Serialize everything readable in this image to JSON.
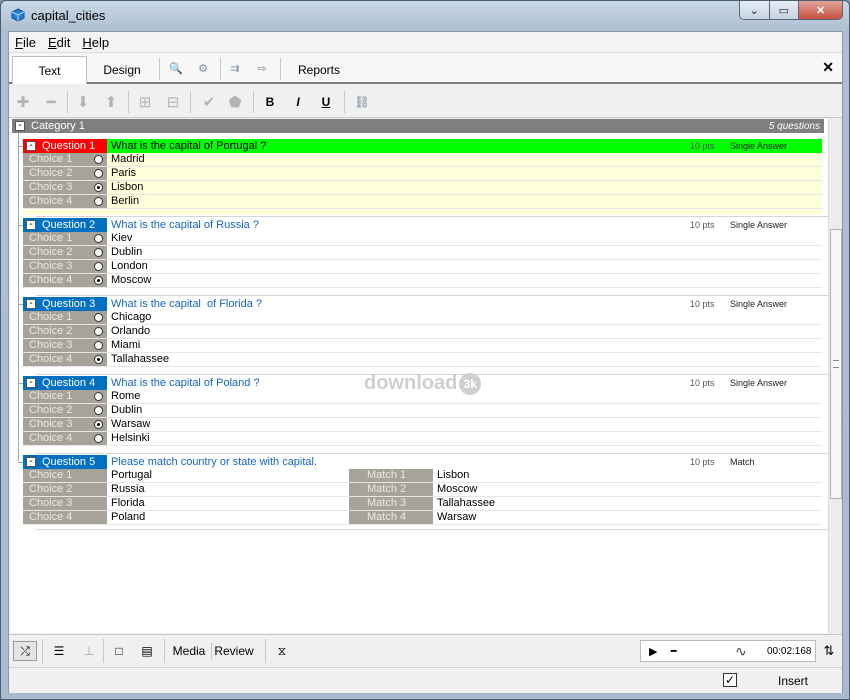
{
  "window": {
    "title": "capital_cities",
    "controls": [
      "⌄",
      "▭",
      "✕"
    ]
  },
  "menu": [
    {
      "letter": "F",
      "rest": "ile"
    },
    {
      "letter": "E",
      "rest": "dit"
    },
    {
      "letter": "H",
      "rest": "elp"
    }
  ],
  "tabs": {
    "text": "Text",
    "design": "Design",
    "reports": "Reports"
  },
  "toolbar_icons": {
    "search": "🔍",
    "zoom": "⚙",
    "sort": "⇉",
    "arrow": "⇨",
    "add": "✚",
    "remove": "━",
    "down": "⬇",
    "up": "⬆",
    "insert_above": "⊞",
    "insert_below": "⊟",
    "check": "✔",
    "shape": "⬟",
    "link": "⛓"
  },
  "format": {
    "bold": "B",
    "italic": "I",
    "underline": "U"
  },
  "category": {
    "expander": "-",
    "label": "Category 1",
    "count": "5 questions"
  },
  "questions": [
    {
      "label": "Question 1",
      "text": "What is the capital of Portugal ?",
      "pts": "10 pts",
      "type": "Single Answer",
      "choices": [
        {
          "label": "Choice 1",
          "text": "Madrid"
        },
        {
          "label": "Choice 2",
          "text": "Paris"
        },
        {
          "label": "Choice 3",
          "text": "Lisbon"
        },
        {
          "label": "Choice 4",
          "text": "Berlin"
        }
      ]
    },
    {
      "label": "Question 2",
      "text": "What is the capital of Russia ?",
      "pts": "10 pts",
      "type": "Single Answer",
      "choices": [
        {
          "label": "Choice 1",
          "text": "Kiev"
        },
        {
          "label": "Choice 2",
          "text": "Dublin"
        },
        {
          "label": "Choice 3",
          "text": "London"
        },
        {
          "label": "Choice 4",
          "text": "Moscow"
        }
      ]
    },
    {
      "label": "Question 3",
      "text": "What is the capital  of Florida ?",
      "pts": "10 pts",
      "type": "Single Answer",
      "choices": [
        {
          "label": "Choice 1",
          "text": "Chicago"
        },
        {
          "label": "Choice 2",
          "text": "Orlando"
        },
        {
          "label": "Choice 3",
          "text": "Miami"
        },
        {
          "label": "Choice 4",
          "text": "Tallahassee"
        }
      ]
    },
    {
      "label": "Question 4",
      "text": "What is the capital of Poland ?",
      "pts": "10 pts",
      "type": "Single Answer",
      "choices": [
        {
          "label": "Choice 1",
          "text": "Rome"
        },
        {
          "label": "Choice 2",
          "text": "Dublin"
        },
        {
          "label": "Choice 3",
          "text": "Warsaw"
        },
        {
          "label": "Choice 4",
          "text": "Helsinki"
        }
      ]
    },
    {
      "label": "Question 5",
      "text": "Please match country or state with capital.",
      "pts": "10 pts",
      "type": "Match",
      "choices": [
        {
          "label": "Choice 1",
          "text": "Portugal"
        },
        {
          "label": "Choice 2",
          "text": "Russia"
        },
        {
          "label": "Choice 3",
          "text": "Florida"
        },
        {
          "label": "Choice 4",
          "text": "Poland"
        }
      ],
      "matches": [
        {
          "label": "Match 1",
          "text": "Lisbon"
        },
        {
          "label": "Match 2",
          "text": "Moscow"
        },
        {
          "label": "Match 3",
          "text": "Tallahassee"
        },
        {
          "label": "Match 4",
          "text": "Warsaw"
        }
      ]
    }
  ],
  "watermark": {
    "text": "download",
    "badge": "3k"
  },
  "bottom": {
    "shuffle": "⤮",
    "list": "☰",
    "pin": "⊥",
    "page": "□",
    "doc": "▤",
    "media": "Media",
    "review": "Review",
    "timer": "⧖",
    "play": "▶",
    "minus": "━",
    "wave": "∿",
    "time": "00:02:168",
    "sort_arrows": "⇅"
  },
  "status": {
    "check": "✓",
    "insert": "Insert"
  },
  "colors": {
    "q1_label": "#ff0000",
    "q1_bar": "#00ff00",
    "q1_bg": "#ffffdc",
    "q_label": "#0071c1",
    "q_text": "#1565c0"
  }
}
